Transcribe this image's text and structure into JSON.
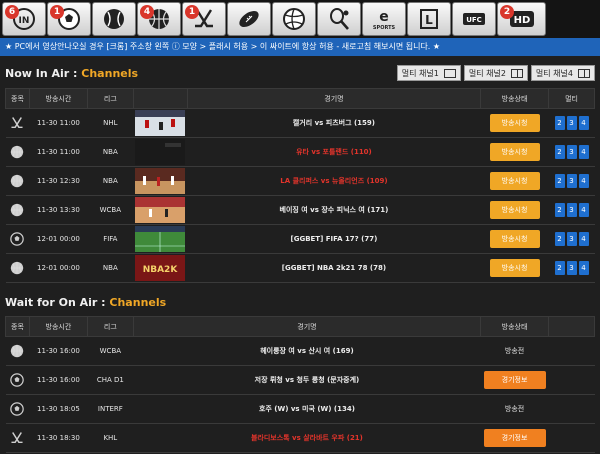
{
  "nav": [
    {
      "icon": "live-icon",
      "badge": "6"
    },
    {
      "icon": "soccer-ball-icon",
      "badge": "1"
    },
    {
      "icon": "baseball-icon",
      "badge": ""
    },
    {
      "icon": "basketball-icon",
      "badge": "4"
    },
    {
      "icon": "hockey-icon",
      "badge": "1"
    },
    {
      "icon": "football-icon",
      "badge": ""
    },
    {
      "icon": "volleyball-icon",
      "badge": ""
    },
    {
      "icon": "tennis-icon",
      "badge": ""
    },
    {
      "icon": "esports-icon",
      "badge": ""
    },
    {
      "icon": "lol-icon",
      "badge": ""
    },
    {
      "icon": "ufc-icon",
      "badge": ""
    },
    {
      "icon": "hd-icon",
      "badge": "2"
    }
  ],
  "notice": "★ PC에서 영상안나오실 경우 [크롬] 주소창 왼쪽 ⓘ 모양 > 플래시 허용 > 이 싸이트에 항상 허용 - 새로고침 해보시면 됩니다. ★",
  "live": {
    "title_main": "Now In Air : ",
    "title_hl": "Channels",
    "multi_buttons": [
      "멀티 채널1",
      "멀티 채널2",
      "멀티 채널4"
    ],
    "headers": {
      "sport": "종목",
      "time": "방송시간",
      "league": "리그",
      "game": "경기명",
      "status": "방송상태",
      "multi": "멀티"
    },
    "rows": [
      {
        "sport": "hockey-icon",
        "time": "11-30 11:00",
        "league": "NHL",
        "game": "캘거리 vs 피츠버그 (159)",
        "red": false,
        "status": "방송시청",
        "thumb": "hockey"
      },
      {
        "sport": "basketball-icon",
        "time": "11-30 11:00",
        "league": "NBA",
        "game": "유타 vs 포틀랜드 (110)",
        "red": true,
        "status": "방송시청",
        "thumb": "dark"
      },
      {
        "sport": "basketball-icon",
        "time": "11-30 12:30",
        "league": "NBA",
        "game": "LA 클리퍼스 vs 뉴올리언즈 (109)",
        "red": true,
        "status": "방송시청",
        "thumb": "court"
      },
      {
        "sport": "basketball-icon",
        "time": "11-30 13:30",
        "league": "WCBA",
        "game": "베이징 여 vs 장수 피닉스 여 (171)",
        "red": false,
        "status": "방송시청",
        "thumb": "court2"
      },
      {
        "sport": "soccer-ball-icon",
        "time": "12-01 00:00",
        "league": "FIFA",
        "game": "[GGBET] FIFA 17? (77)",
        "red": false,
        "status": "방송시청",
        "thumb": "pitch"
      },
      {
        "sport": "basketball-icon",
        "time": "12-01 00:00",
        "league": "NBA",
        "game": "[GGBET] NBA 2k21 78 (78)",
        "red": false,
        "status": "방송시청",
        "thumb": "nba2k"
      }
    ],
    "multi_nums": [
      "2",
      "3",
      "4"
    ]
  },
  "wait": {
    "title_main": "Wait for On Air : ",
    "title_hl": "Channels",
    "headers": {
      "sport": "종목",
      "time": "방송시간",
      "league": "리그",
      "game": "경기명",
      "status": "방송상태"
    },
    "rows": [
      {
        "sport": "basketball-icon",
        "time": "11-30 16:00",
        "league": "WCBA",
        "game": "헤이룽장 여 vs 산시 여 (169)",
        "red": false,
        "status": "방송전",
        "button": false
      },
      {
        "sport": "soccer-ball-icon",
        "time": "11-30 16:00",
        "league": "CHA D1",
        "game": "저장 뤼청 vs 청두 룽청 (문자중계)",
        "red": false,
        "status": "경기정보",
        "button": true
      },
      {
        "sport": "soccer-ball-icon",
        "time": "11-30 18:05",
        "league": "INTERF",
        "game": "호주 (W) vs 미국 (W) (134)",
        "red": false,
        "status": "방송전",
        "button": false
      },
      {
        "sport": "hockey-icon",
        "time": "11-30 18:30",
        "league": "KHL",
        "game": "블라디보스톡 vs 살라바트 우파 (21)",
        "red": true,
        "status": "경기정보",
        "button": true
      }
    ]
  },
  "colors": {
    "accent": "#f0a726",
    "notice_bg": "#1f64b9",
    "red_text": "#e2342b",
    "multi_blue": "#1f6fcf"
  }
}
